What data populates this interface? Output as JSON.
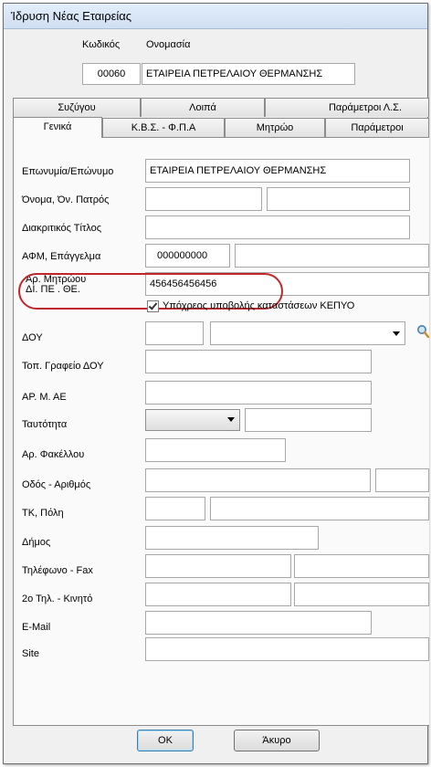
{
  "window": {
    "title": "Ίδρυση Νέας Εταιρείας"
  },
  "header": {
    "code_label": "Κωδικός",
    "name_label": "Ονομασία",
    "code_value": "00060",
    "name_value": "ΕΤΑΙΡΕΙΑ ΠΕΤΡΕΛΑΙΟΥ ΘΕΡΜΑΝΣΗΣ"
  },
  "tabs": {
    "back_row": [
      "Συζύγου",
      "Λοιπά",
      "Παράμετροι Λ.Σ."
    ],
    "front_row": [
      "Γενικά",
      "Κ.Β.Σ. - Φ.Π.Α",
      "Μητρώο",
      "Παράμετροι"
    ],
    "active": "Γενικά"
  },
  "form": {
    "company_name_label": "Επωνυμία/Επώνυμο",
    "company_name_value": "ΕΤΑΙΡΕΙΑ ΠΕΤΡΕΛΑΙΟΥ ΘΕΡΜΑΝΣΗΣ",
    "father_name_label": "Όνομα, Όν. Πατρός",
    "distinctive_title_label": "Διακριτικός Τίτλος",
    "vat_label": "ΑΦΜ, Επάγγελμα",
    "vat_value": "000000000",
    "registry_label_line1": "Αρ. Μητρώου",
    "registry_label_line2": "ΔΙ. ΠΕ . ΘΕ.",
    "registry_value": "456456456456",
    "kepyo_label": "Υπόχρεος υποβολής καταστάσεων ΚΕΠΥΟ",
    "kepyo_checked": true,
    "doy_label": "ΔΟΥ",
    "doy_office_label": "Τοπ. Γραφείο ΔΟΥ",
    "ar_m_ae_label": "ΑΡ. Μ. ΑΕ",
    "id_label": "Ταυτότητα",
    "folder_label": "Αρ. Φακέλλου",
    "street_label": "Οδός - Αριθμός",
    "postal_city_label": "ΤΚ, Πόλη",
    "municipality_label": "Δήμος",
    "phone_fax_label": "Τηλέφωνο - Fax",
    "phone2_mobile_label": "2ο Τηλ. - Κινητό",
    "email_label": "E-Mail",
    "site_label": "Site"
  },
  "buttons": {
    "ok": "OK",
    "cancel": "Άκυρο"
  },
  "colors": {
    "annotation": "#c0272d",
    "window_bg": "#f0f0f0",
    "panel_bg": "#fafafa"
  }
}
